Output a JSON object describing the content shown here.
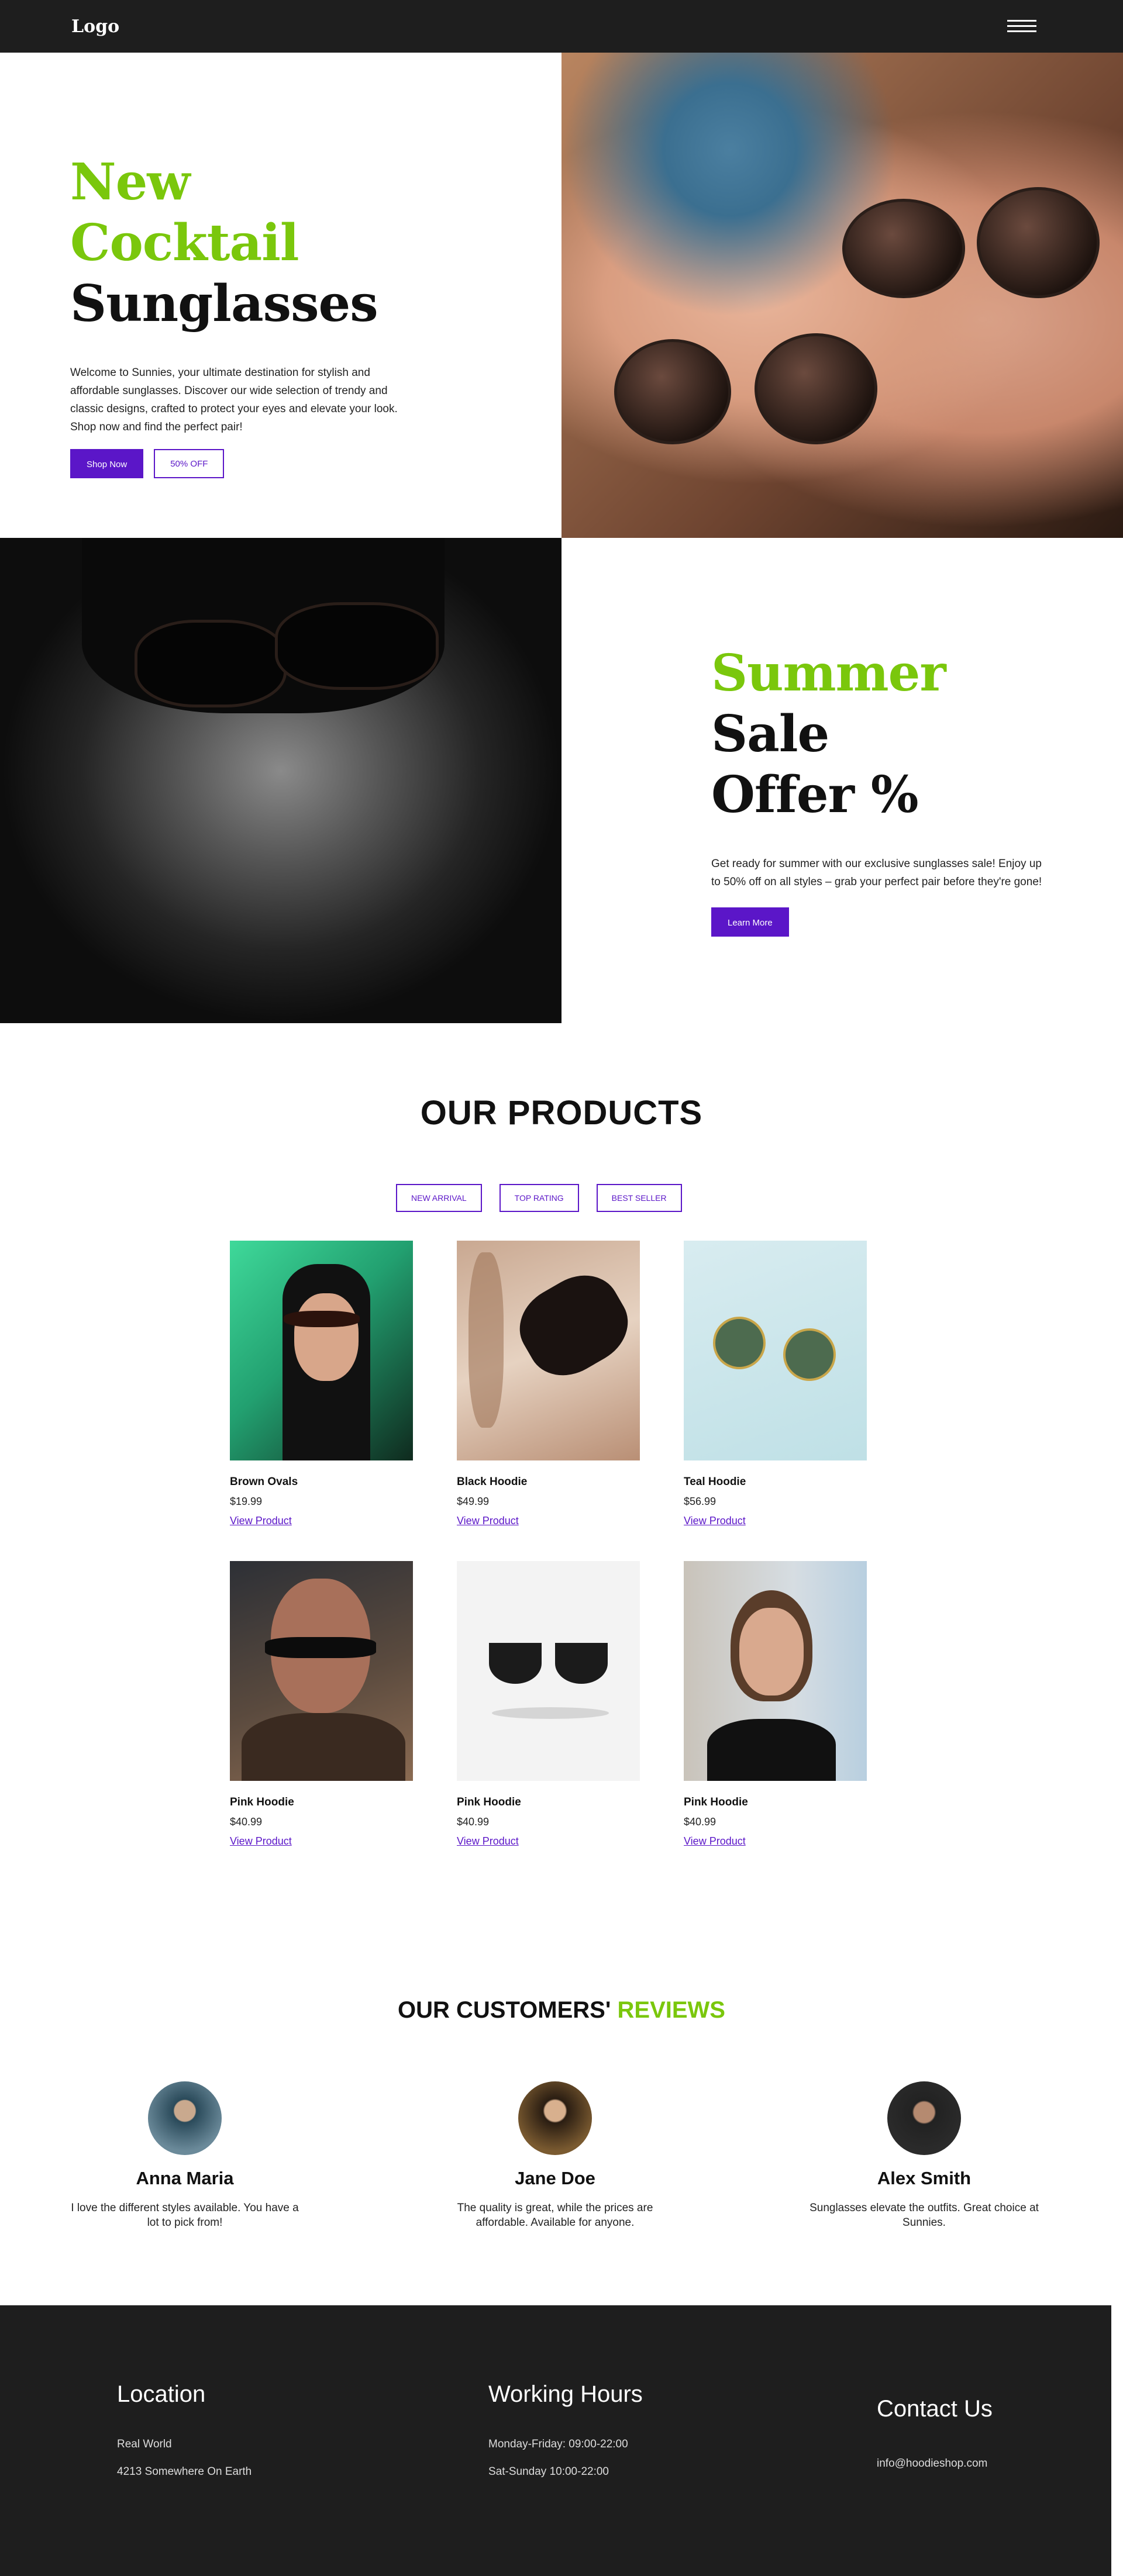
{
  "nav": {
    "logo": "Logo",
    "menu_icon": "hamburger-menu-icon"
  },
  "hero": {
    "title_green": "New Cocktail",
    "title_dark": "Sunglasses",
    "description": "Welcome to Sunnies, your ultimate destination for stylish and affordable sunglasses. Discover our wide selection of trendy and classic designs, crafted to protect your eyes and elevate your look. Shop now and find the perfect pair!",
    "shop_button": "Shop Now",
    "offer_button": "50% OFF"
  },
  "sale": {
    "title_green": "Summer",
    "title_dark_1": "Sale",
    "title_dark_2": "Offer %",
    "description": "Get ready for summer with our exclusive sunglasses sale! Enjoy up to 50% off on all styles – grab your perfect pair before they're gone!",
    "button": "Learn More"
  },
  "products": {
    "title": "OUR PRODUCTS",
    "filters": [
      "NEW ARRIVAL",
      "TOP RATING",
      "BEST SELLER"
    ],
    "items": [
      {
        "name": "Brown Ovals",
        "price": "$19.99",
        "link": "View Product"
      },
      {
        "name": "Black Hoodie",
        "price": "$49.99",
        "link": "View Product"
      },
      {
        "name": "Teal Hoodie",
        "price": "$56.99",
        "link": "View Product"
      },
      {
        "name": "Pink Hoodie",
        "price": "$40.99",
        "link": "View Product"
      },
      {
        "name": "Pink Hoodie",
        "price": "$40.99",
        "link": "View Product"
      },
      {
        "name": "Pink Hoodie",
        "price": "$40.99",
        "link": "View Product"
      }
    ]
  },
  "reviews": {
    "title_dark": "OUR CUSTOMERS'",
    "title_green": "REVIEWS",
    "items": [
      {
        "name": "Anna Maria",
        "text": "I love the different styles available. You have a lot to pick from!"
      },
      {
        "name": "Jane Doe",
        "text": "The quality is great, while the prices are affordable. Available for anyone."
      },
      {
        "name": "Alex Smith",
        "text": "Sunglasses elevate the outfits. Great choice at Sunnies."
      }
    ]
  },
  "footer": {
    "location": {
      "heading": "Location",
      "line1": "Real World",
      "line2": "4213 Somewhere On Earth"
    },
    "hours": {
      "heading": "Working Hours",
      "line1": "Monday-Friday: 09:00-22:00",
      "line2": "Sat-Sunday 10:00-22:00"
    },
    "contact": {
      "heading": "Contact Us",
      "email": "info@hoodieshop.com"
    }
  },
  "colors": {
    "accent": "#5b16c8",
    "green": "#7ac70c",
    "dark": "#1e1e1e"
  }
}
